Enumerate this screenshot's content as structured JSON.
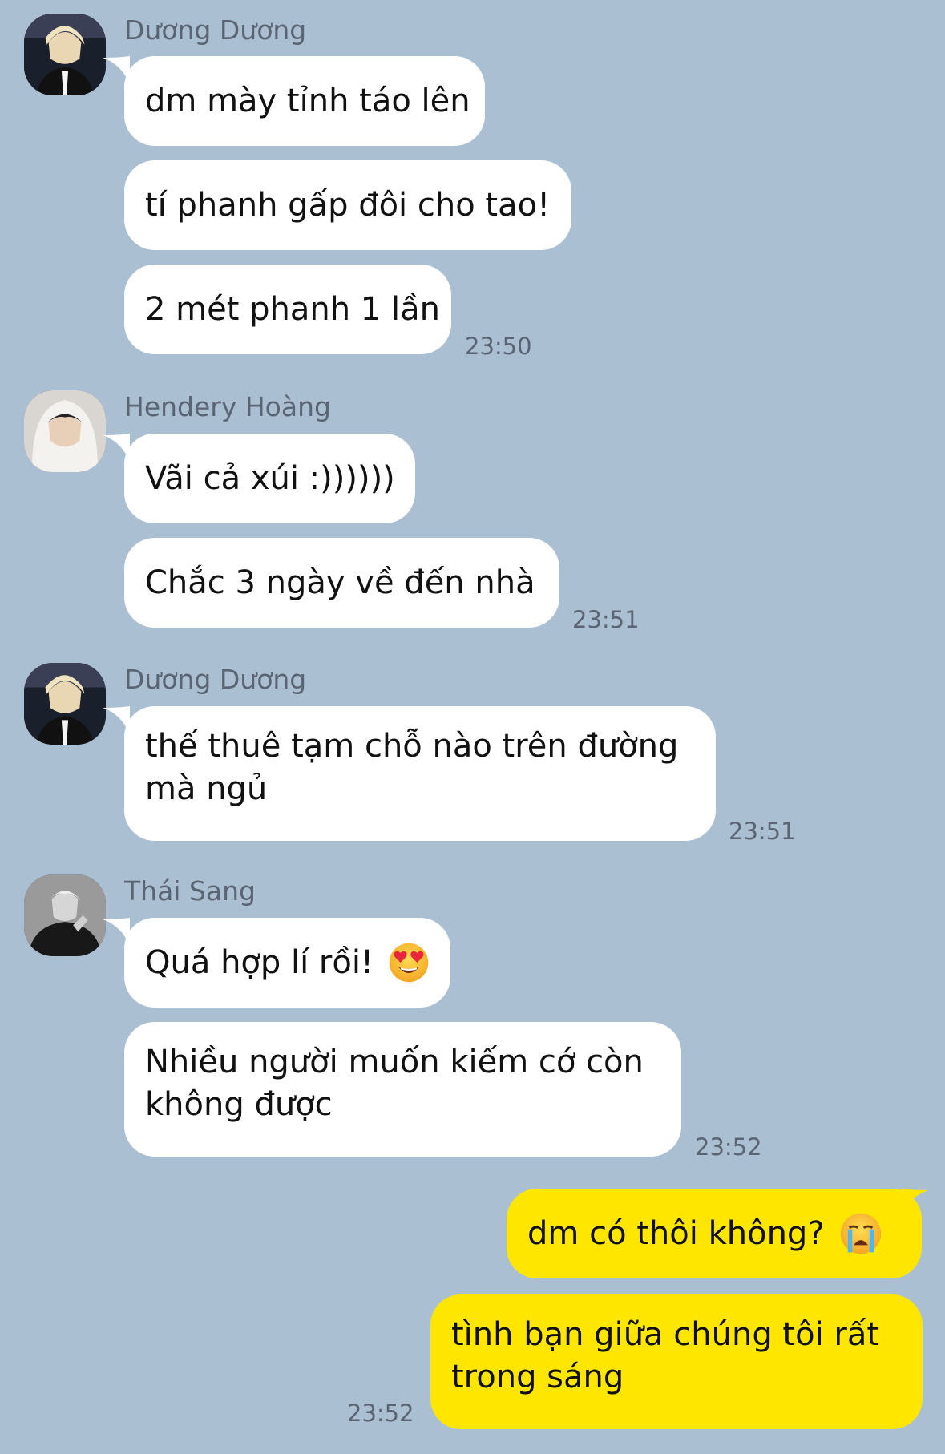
{
  "chat": {
    "groups": [
      {
        "sender": "Dương Dương",
        "avatar_icon": "avatar-duong-duong",
        "messages": [
          "dm mày tỉnh táo lên",
          "tí phanh gấp đôi cho tao!",
          "2 mét phanh 1 lần"
        ],
        "time": "23:50"
      },
      {
        "sender": "Hendery Hoàng",
        "avatar_icon": "avatar-hendery-hoang",
        "messages": [
          "Vãi cả xúi :))))))",
          "Chắc 3 ngày về đến nhà"
        ],
        "time": "23:51"
      },
      {
        "sender": "Dương Dương",
        "avatar_icon": "avatar-duong-duong",
        "messages": [
          "thế thuê tạm chỗ nào trên đường\nmà ngủ"
        ],
        "time": "23:51"
      },
      {
        "sender": "Thái Sang",
        "avatar_icon": "avatar-thai-sang",
        "messages": [
          "Quá hợp lí rồi!",
          "Nhiều người muốn kiếm cớ còn\nkhông được"
        ],
        "emoji": "heart-eyes-emoji",
        "time": "23:52"
      }
    ],
    "mine": {
      "messages": [
        "dm có thôi không?",
        "tình bạn giữa chúng tôi rất\ntrong sáng"
      ],
      "emoji": "crying-emoji",
      "time": "23:52"
    }
  },
  "colors": {
    "background": "#abbfd3",
    "incoming_bubble": "#ffffff",
    "outgoing_bubble": "#ffe600",
    "meta_text": "#5a6472"
  }
}
